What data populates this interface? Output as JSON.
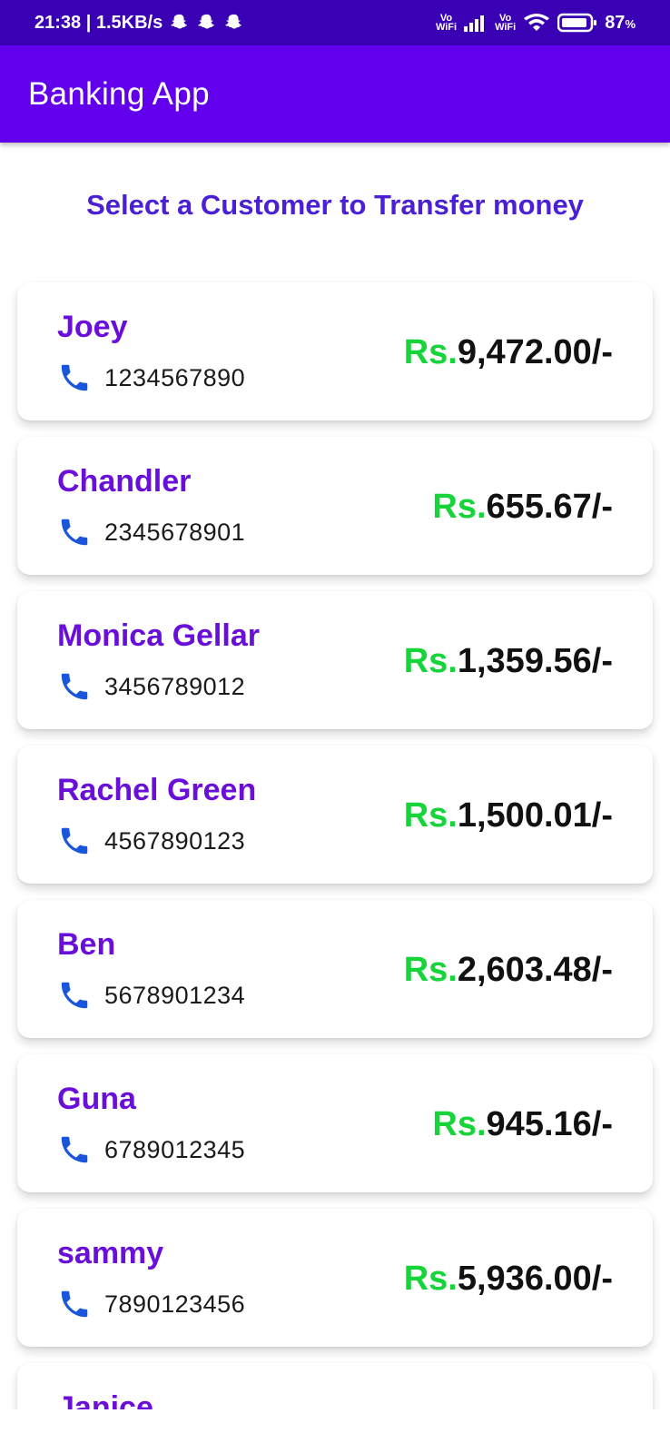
{
  "status_bar": {
    "time_speed": "21:38 | 1.5KB/s",
    "vowifi_top": "Vo",
    "vowifi_bottom": "WiFi",
    "battery": "87"
  },
  "app_bar": {
    "title": "Banking App"
  },
  "heading": "Select a Customer to Transfer money",
  "customers": [
    {
      "name": "Joey",
      "phone": "1234567890",
      "currency": "Rs.",
      "amount": "9,472.00/-"
    },
    {
      "name": "Chandler",
      "phone": "2345678901",
      "currency": "Rs.",
      "amount": "655.67/-"
    },
    {
      "name": "Monica Gellar",
      "phone": "3456789012",
      "currency": "Rs.",
      "amount": "1,359.56/-"
    },
    {
      "name": "Rachel Green",
      "phone": "4567890123",
      "currency": "Rs.",
      "amount": "1,500.01/-"
    },
    {
      "name": "Ben",
      "phone": "5678901234",
      "currency": "Rs.",
      "amount": "2,603.48/-"
    },
    {
      "name": "Guna",
      "phone": "6789012345",
      "currency": "Rs.",
      "amount": "945.16/-"
    },
    {
      "name": "sammy",
      "phone": "7890123456",
      "currency": "Rs.",
      "amount": "5,936.00/-"
    },
    {
      "name": "Janice",
      "phone": "",
      "currency": "",
      "amount": ""
    }
  ],
  "colors": {
    "status_bar": "#3a00b3",
    "app_bar": "#6200ee",
    "heading": "#4a1fd6",
    "name": "#6a0fd9",
    "currency": "#16d43a",
    "phone_icon": "#1a56db"
  },
  "icons": {
    "phone": "phone-icon",
    "status_ghost": "snapchat-icon",
    "signal": "signal-icon",
    "wifi": "wifi-icon",
    "battery": "battery-icon"
  }
}
